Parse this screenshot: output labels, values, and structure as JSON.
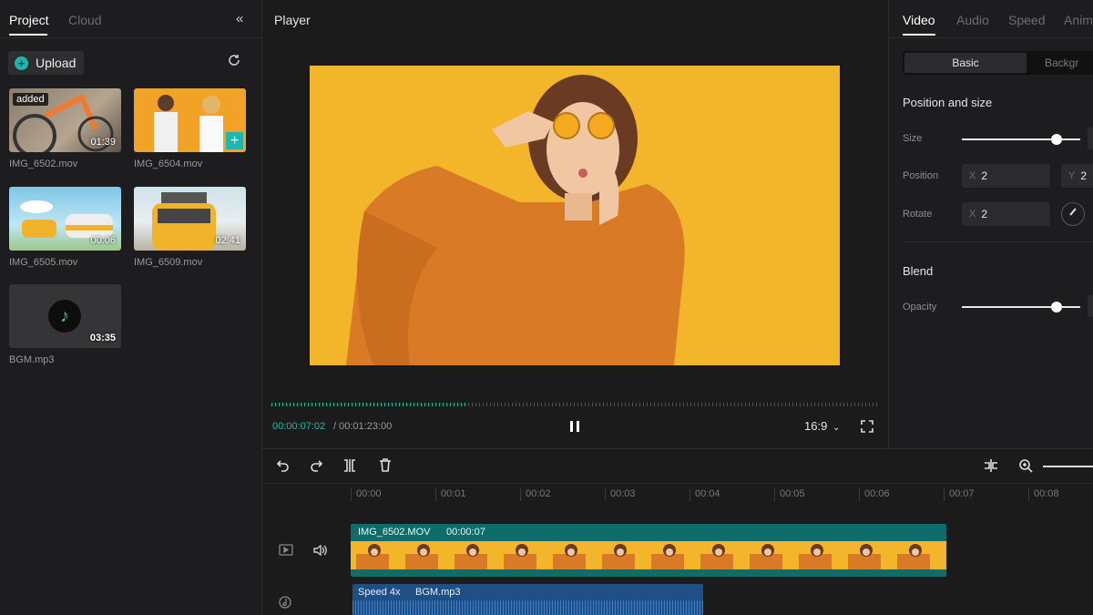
{
  "left_panel": {
    "tabs": [
      {
        "label": "Project"
      },
      {
        "label": "Cloud"
      }
    ],
    "collapse_icon": "double-chevron-left-icon",
    "upload_label": "Upload",
    "refresh_icon": "refresh-icon",
    "media": [
      {
        "name": "IMG_6502.mov",
        "duration": "01:39",
        "badge": "added"
      },
      {
        "name": "IMG_6504.mov",
        "duration": "",
        "add_icon": "+"
      },
      {
        "name": "IMG_6505.mov",
        "duration": "00:06"
      },
      {
        "name": "IMG_6509.mov",
        "duration": "02:41"
      },
      {
        "name": "BGM.mp3",
        "duration": "03:35"
      }
    ]
  },
  "player": {
    "title": "Player",
    "current_time": "00:00:07:02",
    "total_time": "/ 00:01:23:00",
    "aspect_ratio": "16:9",
    "progress": 0.32
  },
  "right_panel": {
    "tabs": [
      {
        "label": "Video"
      },
      {
        "label": "Audio"
      },
      {
        "label": "Speed"
      },
      {
        "label": "Anim"
      }
    ],
    "subtabs": [
      {
        "label": "Basic"
      },
      {
        "label": "Backgr"
      }
    ],
    "position_size_title": "Position and size",
    "size_label": "Size",
    "size_value": 0.8,
    "position_label": "Position",
    "pos_x_axis": "X",
    "pos_x": "2",
    "pos_y_axis": "Y",
    "pos_y": "2",
    "rotate_label": "Rotate",
    "rot_x_axis": "X",
    "rot_x": "2",
    "blend_title": "Blend",
    "opacity_label": "Opacity",
    "opacity_value": 0.8
  },
  "timeline": {
    "ruler": [
      "00:00",
      "00:01",
      "00:02",
      "00:03",
      "00:04",
      "00:05",
      "00:06",
      "00:07",
      "00:08"
    ],
    "video_clip": {
      "name": "IMG_6502.MOV",
      "time": "00:00:07"
    },
    "audio_clip": {
      "speed": "Speed 4x",
      "name": "BGM.mp3"
    }
  },
  "colors": {
    "accent": "#1fb6b0",
    "clip_teal": "#0e6d6a",
    "audio_blue": "#1e4f86",
    "photo_bg": "#f3b52a",
    "sweater": "#d97a27"
  }
}
